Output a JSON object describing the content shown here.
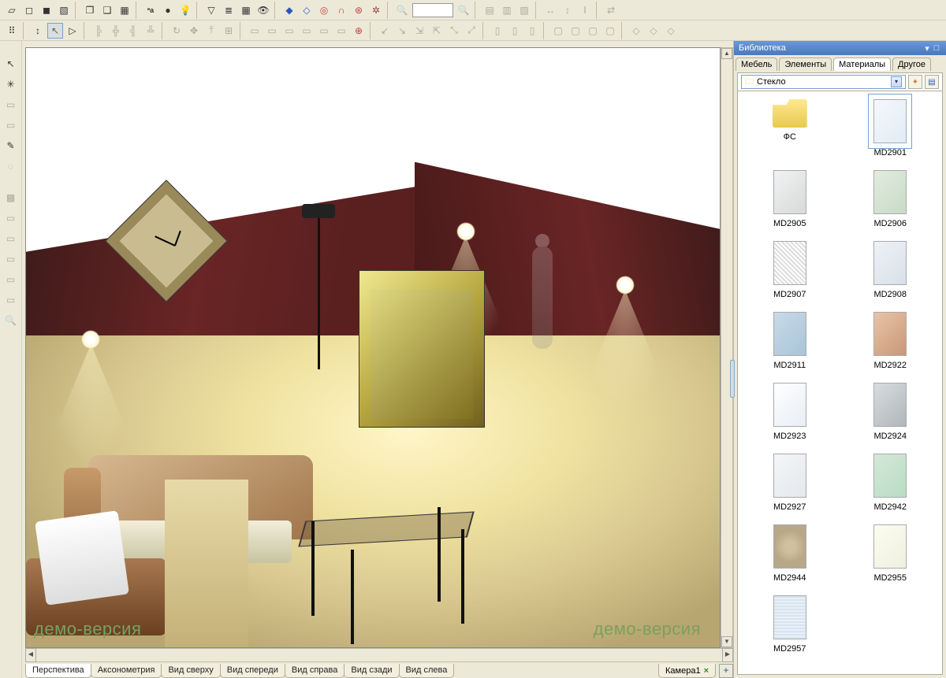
{
  "watermark": "демо-версия",
  "view_tabs": {
    "list": [
      "Перспектива",
      "Аксонометрия",
      "Вид сверху",
      "Вид спереди",
      "Вид справа",
      "Вид сзади",
      "Вид слева"
    ],
    "active_index": 0,
    "camera": "Камера1"
  },
  "library": {
    "title": "Библиотека",
    "tabs": [
      "Мебель",
      "Элементы",
      "Материалы",
      "Другое"
    ],
    "active_tab_index": 2,
    "combo_value": "Стекло",
    "items": [
      {
        "label": "ФС",
        "kind": "folder"
      },
      {
        "label": "MD2901",
        "kind": "glass",
        "bg": "linear-gradient(135deg,#f5f8fc,#e0ecf5)",
        "selected": true
      },
      {
        "label": "MD2905",
        "kind": "glass",
        "bg": "linear-gradient(135deg,#f0f2f4,#d8dad8)"
      },
      {
        "label": "MD2906",
        "kind": "glass",
        "bg": "linear-gradient(135deg,#e2ecde,#c8dac8)"
      },
      {
        "label": "MD2907",
        "kind": "glass",
        "bg": "repeating-linear-gradient(45deg,#ddd 0 2px,#fff 2px 4px)"
      },
      {
        "label": "MD2908",
        "kind": "glass",
        "bg": "linear-gradient(135deg,#eef2f6,#d8e0e8)"
      },
      {
        "label": "MD2911",
        "kind": "glass",
        "bg": "linear-gradient(135deg,#c8dae8,#a8c4d8)"
      },
      {
        "label": "MD2922",
        "kind": "glass",
        "bg": "linear-gradient(135deg,#e8c4a8,#c89878)"
      },
      {
        "label": "MD2923",
        "kind": "glass",
        "bg": "linear-gradient(135deg,#ffffff,#e8eef4)"
      },
      {
        "label": "MD2924",
        "kind": "glass",
        "bg": "linear-gradient(135deg,#d8dce0,#b0b6ba)"
      },
      {
        "label": "MD2927",
        "kind": "glass",
        "bg": "linear-gradient(135deg,#f4f6f8,#e4e8ec)"
      },
      {
        "label": "MD2942",
        "kind": "glass",
        "bg": "linear-gradient(135deg,#d4e8d8,#b8dcc4)"
      },
      {
        "label": "MD2944",
        "kind": "glass",
        "bg": "radial-gradient(circle,#d0c0a0 20%,#b8a888 60%)"
      },
      {
        "label": "MD2955",
        "kind": "glass",
        "bg": "linear-gradient(135deg,#fcfcf0,#f0f0e0)"
      },
      {
        "label": "MD2957",
        "kind": "glass",
        "bg": "repeating-linear-gradient(0deg,#d8e4f0 0 2px,#e8f0f8 2px 4px)"
      }
    ]
  },
  "icons": {
    "row1": [
      "new-doc",
      "cube",
      "cube-solid",
      "cube-shaded",
      "box",
      "box-open",
      "box-blue",
      "sep",
      "text-label",
      "sphere",
      "bulb",
      "sep",
      "cone",
      "ruler",
      "grid",
      "eye",
      "sep",
      "diamond-blue",
      "diamond-outline",
      "compass",
      "magnet-red",
      "target-red",
      "cog",
      "sep",
      "zoom",
      "zoom-box",
      "zoom-fit",
      "sep",
      "layers",
      "layer-up",
      "layer-dn",
      "sep",
      "dim-h",
      "dim-v",
      "dim-t",
      "sep",
      "link"
    ],
    "row2": [
      "grid-dot",
      "sep",
      "move-v",
      "pointer",
      "pencil-edge",
      "sep",
      "align1",
      "align2",
      "align3",
      "align4",
      "sep",
      "rotate",
      "move",
      "top",
      "center",
      "sep",
      "a1",
      "a2",
      "a3",
      "a4",
      "a5",
      "a6",
      "a7",
      "sep",
      "d1",
      "d2",
      "d3",
      "d4",
      "d5",
      "d6",
      "sep",
      "v1",
      "v2",
      "v3",
      "sep",
      "s1",
      "s2",
      "s3",
      "s4",
      "sep",
      "t1",
      "t2",
      "t3"
    ],
    "left": [
      "pointer",
      "burst",
      "blank",
      "blank",
      "eyedropper",
      "lasso",
      "blank",
      "graph",
      "blank",
      "blank",
      "blank",
      "blank",
      "blank",
      "zoom-rect"
    ]
  }
}
